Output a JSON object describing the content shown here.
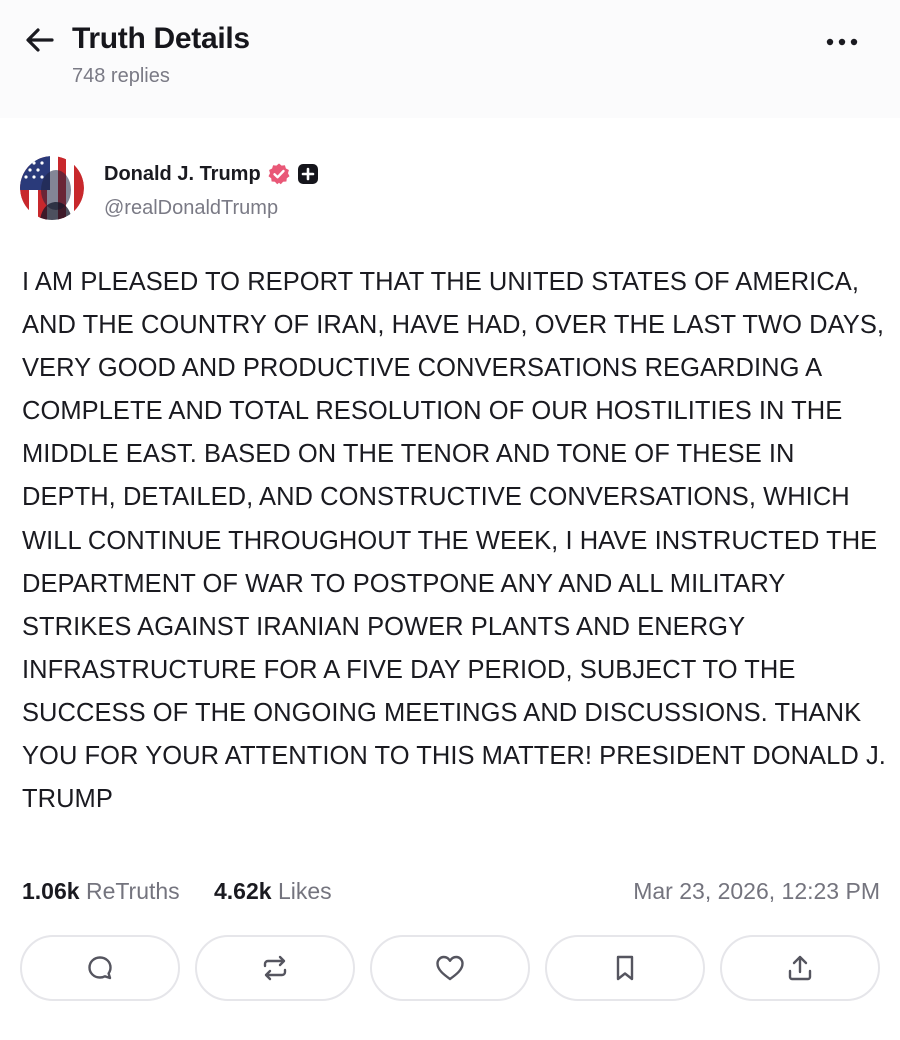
{
  "header": {
    "title": "Truth Details",
    "replies": "748 replies"
  },
  "post": {
    "author": {
      "name": "Donald J. Trump",
      "handle": "@realDonaldTrump"
    },
    "text": "I AM PLEASED TO REPORT THAT THE UNITED STATES OF AMERICA, AND THE COUNTRY OF IRAN, HAVE HAD, OVER THE LAST TWO DAYS, VERY GOOD AND PRODUCTIVE CONVERSATIONS REGARDING A COMPLETE AND TOTAL RESOLUTION OF OUR HOSTILITIES IN THE MIDDLE EAST. BASED ON THE TENOR AND TONE OF THESE IN DEPTH, DETAILED, AND CONSTRUCTIVE CONVERSATIONS, WHICH WILL CONTINUE THROUGHOUT THE WEEK, I HAVE INSTRUCTED THE DEPARTMENT OF WAR TO POSTPONE ANY AND ALL MILITARY STRIKES AGAINST IRANIAN POWER PLANTS AND ENERGY INFRASTRUCTURE FOR A FIVE DAY PERIOD, SUBJECT TO THE SUCCESS OF THE ONGOING MEETINGS AND DISCUSSIONS. THANK YOU FOR YOUR ATTENTION TO THIS MATTER! PRESIDENT DONALD J. TRUMP",
    "stats": {
      "retruths_count": "1.06k",
      "retruths_label": "ReTruths",
      "likes_count": "4.62k",
      "likes_label": "Likes"
    },
    "timestamp": "Mar 23, 2026, 12:23 PM"
  },
  "icons": {
    "back": "arrow-left-icon",
    "more": "more-horizontal-icon",
    "verified": "verified-badge-icon",
    "plus": "plus-badge-icon",
    "reply": "reply-icon",
    "retruth": "retruth-icon",
    "like": "heart-icon",
    "bookmark": "bookmark-icon",
    "share": "share-icon"
  },
  "colors": {
    "verified": "#e95877",
    "text": "#1a1a20",
    "muted": "#74747e",
    "border": "#e6e6ea",
    "header_bg": "#fbfbfc"
  }
}
